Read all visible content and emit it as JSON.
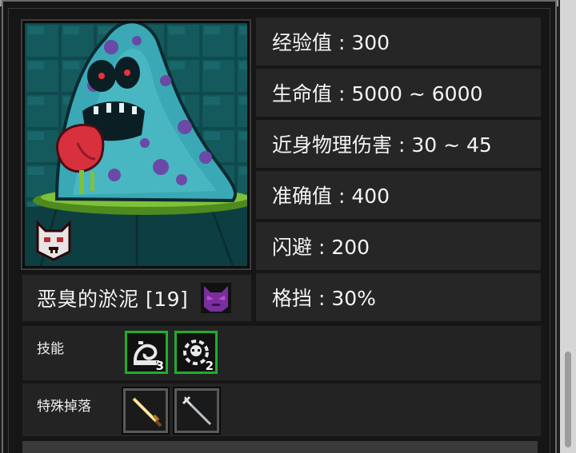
{
  "monster": {
    "name": "恶臭的淤泥 [19]",
    "portrait_icon": "slime-ghost-portrait",
    "rank_badge_icon": "demon-mask-icon",
    "tier_icon": "purple-cat-demon-icon"
  },
  "stats": [
    {
      "label": "经验值 : 300"
    },
    {
      "label": "生命值 : 5000 ~ 6000"
    },
    {
      "label": "近身物理伤害 : 30 ~ 45"
    },
    {
      "label": "准确值 : 400"
    },
    {
      "label": "闪避 : 200"
    },
    {
      "label": "格挡 : 30%"
    }
  ],
  "skills": {
    "label": "技能",
    "items": [
      {
        "icon": "slime-swirl-skill-icon",
        "count": "3"
      },
      {
        "icon": "skull-gear-skill-icon",
        "count": "2"
      }
    ]
  },
  "drops": {
    "label": "特殊掉落",
    "items": [
      {
        "icon": "golden-sword-icon"
      },
      {
        "icon": "silver-spear-icon"
      }
    ]
  },
  "colors": {
    "skill_border": "#1fae2c",
    "panel_bg": "#262626",
    "slime": "#3aa9b5",
    "tongue": "#d8303d"
  }
}
